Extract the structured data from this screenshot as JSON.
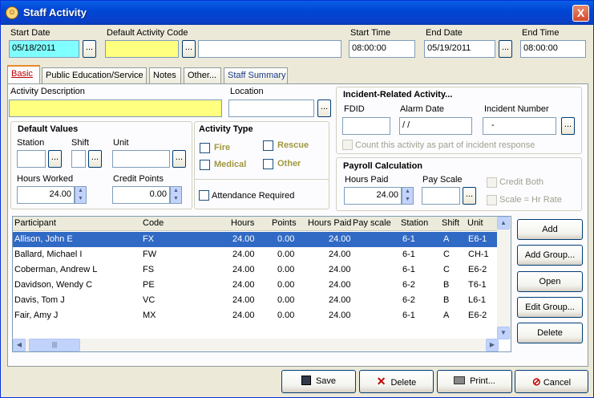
{
  "window": {
    "title": "Staff Activity",
    "close_label": "X"
  },
  "header": {
    "start_date_label": "Start Date",
    "start_date_value": "05/18/2011",
    "default_activity_code_label": "Default Activity Code",
    "default_activity_code_value": "",
    "activity_code_desc_value": "",
    "start_time_label": "Start Time",
    "start_time_value": "08:00:00",
    "end_date_label": "End Date",
    "end_date_value": "05/19/2011",
    "end_time_label": "End Time",
    "end_time_value": "08:00:00",
    "ellipsis": "..."
  },
  "tabs": [
    "Basic",
    "Public Education/Service",
    "Notes",
    "Other...",
    "Staff Summary"
  ],
  "basic": {
    "activity_description_label": "Activity Description",
    "activity_description_value": "",
    "location_label": "Location",
    "location_value": "",
    "default_values_title": "Default Values",
    "station_label": "Station",
    "shift_label": "Shift",
    "unit_label": "Unit",
    "hours_worked_label": "Hours Worked",
    "hours_worked_value": "24.00",
    "credit_points_label": "Credit Points",
    "credit_points_value": "0.00",
    "activity_type_title": "Activity Type",
    "activity_types": [
      "Fire",
      "Rescue",
      "Medical",
      "Other"
    ],
    "attendance_required_label": "Attendance Required",
    "incident_title": "Incident-Related Activity...",
    "fdid_label": "FDID",
    "alarm_date_label": "Alarm Date",
    "alarm_date_value": " / /",
    "incident_number_label": "Incident Number",
    "incident_number_value": "-",
    "count_activity_label": "Count this activity as part of incident response",
    "payroll_title": "Payroll Calculation",
    "hours_paid_label": "Hours Paid",
    "hours_paid_value": "24.00",
    "pay_scale_label": "Pay Scale",
    "credit_both_label": "Credit Both",
    "scale_hr_rate_label": "Scale = Hr Rate"
  },
  "grid": {
    "columns": [
      "Participant",
      "Code",
      "Hours",
      "Points",
      "Hours Paid",
      "Pay scale",
      "Station",
      "Shift",
      "Unit"
    ],
    "rows": [
      [
        "Allison, John E",
        "FX",
        "24.00",
        "0.00",
        "24.00",
        "",
        "6-1",
        "A",
        "E6-1"
      ],
      [
        "Ballard, Michael I",
        "FW",
        "24.00",
        "0.00",
        "24.00",
        "",
        "6-1",
        "C",
        "CH-1"
      ],
      [
        "Coberman, Andrew L",
        "FS",
        "24.00",
        "0.00",
        "24.00",
        "",
        "6-1",
        "C",
        "E6-2"
      ],
      [
        "Davidson, Wendy C",
        "PE",
        "24.00",
        "0.00",
        "24.00",
        "",
        "6-2",
        "B",
        "T6-1"
      ],
      [
        "Davis, Tom J",
        "VC",
        "24.00",
        "0.00",
        "24.00",
        "",
        "6-2",
        "B",
        "L6-1"
      ],
      [
        "Fair, Amy J",
        "MX",
        "24.00",
        "0.00",
        "24.00",
        "",
        "6-1",
        "A",
        "E6-2"
      ]
    ]
  },
  "side_buttons": [
    "Add",
    "Add Group...",
    "Open",
    "Edit Group...",
    "Delete"
  ],
  "bottom_buttons": {
    "save": "Save",
    "delete": "Delete",
    "print": "Print...",
    "cancel": "Cancel"
  }
}
